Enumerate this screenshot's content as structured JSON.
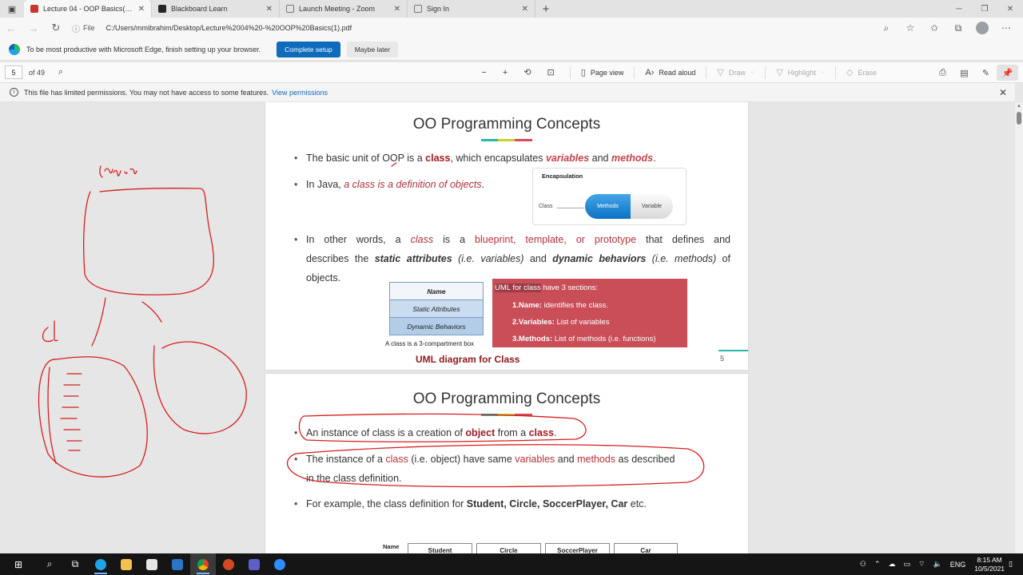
{
  "tabs": [
    {
      "label": "Lecture 04 - OOP Basics(1).pdf",
      "color": "#c9362f",
      "active": true
    },
    {
      "label": "Blackboard Learn",
      "color": "#262626",
      "active": false
    },
    {
      "label": "Launch Meeting - Zoom",
      "color": "#7a7a7a",
      "active": false
    },
    {
      "label": "Sign In",
      "color": "#7a7a7a",
      "active": false
    }
  ],
  "address": {
    "scheme_label": "File",
    "url": "C:/Users/mmibrahim/Desktop/Lecture%2004%20-%20OOP%20Basics(1).pdf"
  },
  "promo": {
    "text": "To be most productive with Microsoft Edge, finish setting up your browser.",
    "primary": "Complete setup",
    "secondary": "Maybe later"
  },
  "pdf_toolbar": {
    "page": "5",
    "of": "of 49",
    "page_view": "Page view",
    "read_aloud": "Read aloud",
    "draw": "Draw",
    "highlight": "Highlight",
    "erase": "Erase"
  },
  "permissions": {
    "text": "This file has limited permissions. You may not have access to some features.",
    "link": "View permissions"
  },
  "slide1": {
    "title": "OO Programming Concepts",
    "b1": {
      "pre": "The basic unit of OOP is a ",
      "class": "class",
      "mid": ", which encapsulates ",
      "vars": "variables",
      "and": " and ",
      "methods": "methods",
      "end": "."
    },
    "b2": {
      "pre": "In Java, ",
      "emph": "a class is a definition of objects",
      "end": "."
    },
    "b3": {
      "pre": "In other words, a ",
      "class": "class",
      "is": " is a ",
      "bp": "blueprint, template, or prototype",
      "defines": " that defines and",
      "l2_pre": "describes the ",
      "static": "static attributes",
      "iv": " (i.e. variables)",
      "and": " and ",
      "dyn": "dynamic behaviors",
      "im": " (i.e. methods)",
      "of": " of",
      "l3": "objects."
    },
    "encap": {
      "title": "Encapsulation",
      "class": "Class",
      "methods": "Methods",
      "variable": "Variable"
    },
    "uml_cells": [
      "Name",
      "Static Attributes",
      "Dynamic Behaviors"
    ],
    "uml_caption": "A class is a 3-compartment box",
    "uml_heading": "UML diagram for Class",
    "uml_box": {
      "hl": "UML for class",
      "rest": " have 3 sections:",
      "r1b": "1.Name:",
      "r1": " identifies the class.",
      "r2b": "2.Variables:",
      "r2": " List of variables",
      "r3b": "3.Methods:",
      "r3": "  List of methods (i.e. functions)"
    },
    "page_number": "5"
  },
  "slide2": {
    "title": "OO Programming Concepts",
    "b1": {
      "pre": "An instance of class is a creation of ",
      "obj": "object",
      "mid": " from a ",
      "class": "class",
      "end": "."
    },
    "b2": {
      "pre": "The instance of a ",
      "class": "class",
      "mid": " (i.e. object) have same ",
      "vars": "variables",
      "and": " and ",
      "methods": "methods",
      "end": " as described",
      "l2": "in the class definition."
    },
    "b3": {
      "pre": "For example, the class definition for ",
      "list": "Student, Circle, SoccerPlayer, Car",
      "end": " etc."
    },
    "table_label": "Name",
    "tables": [
      "Student",
      "Circle",
      "SoccerPlayer",
      "Car"
    ]
  },
  "taskbar": {
    "lang": "ENG",
    "time": "8:15 AM",
    "date": "10/5/2021"
  },
  "colors": {
    "accent": "#0f6cbd",
    "ink": "#d81e1e",
    "uml_box": "#c94e58"
  }
}
